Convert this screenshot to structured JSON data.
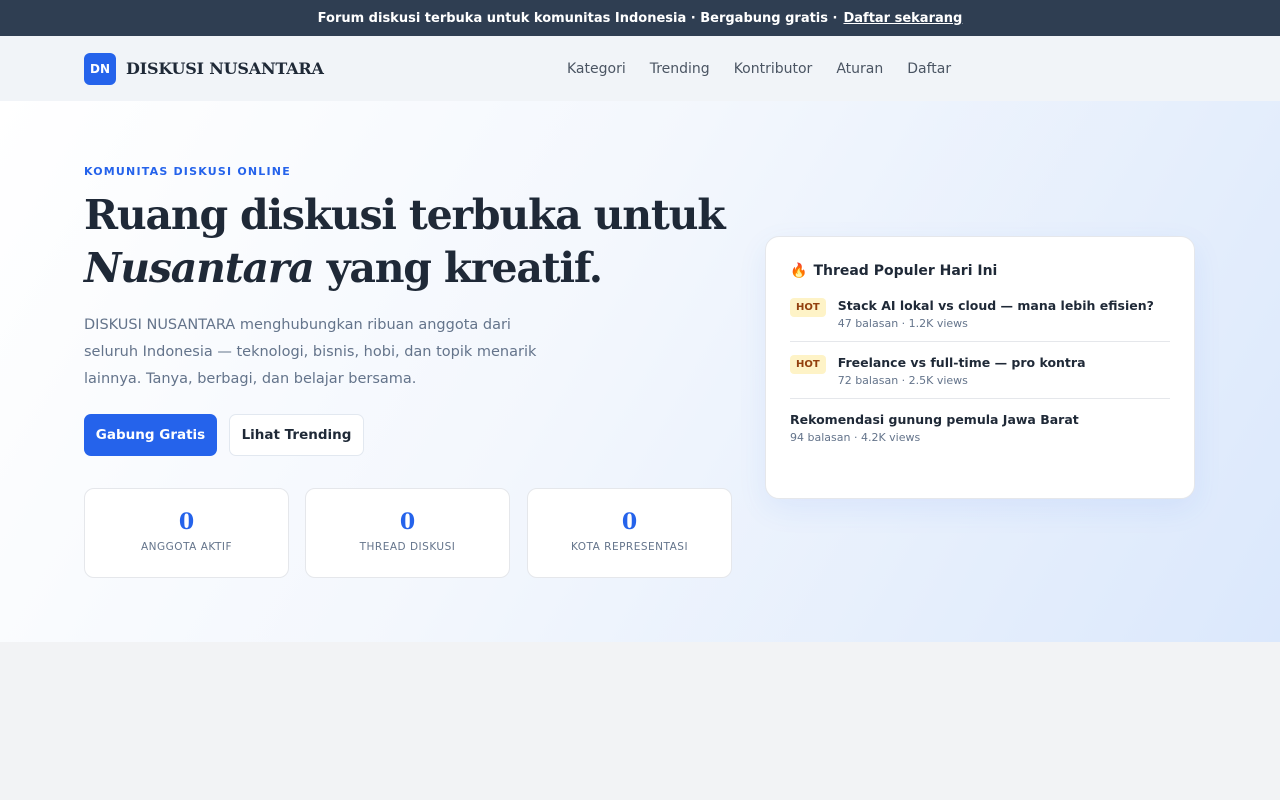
{
  "announcement": {
    "text": "Forum diskusi terbuka untuk komunitas Indonesia · Bergabung gratis ·",
    "link": "Daftar sekarang"
  },
  "header": {
    "logo_initials": "DN",
    "brand": "DISKUSI NUSANTARA",
    "nav": [
      "Kategori",
      "Trending",
      "Kontributor",
      "Aturan",
      "Daftar"
    ]
  },
  "hero": {
    "eyebrow": "KOMUNITAS DISKUSI ONLINE",
    "headline_line1": "Ruang diskusi terbuka untuk",
    "headline_italic": "Nusantara",
    "headline_line2_rest": " yang kreatif.",
    "lede": "DISKUSI NUSANTARA menghubungkan ribuan anggota dari seluruh Indonesia — teknologi, bisnis, hobi, dan topik menarik lainnya. Tanya, berbagi, dan belajar bersama.",
    "primary_cta": "Gabung Gratis",
    "secondary_cta": "Lihat Trending"
  },
  "stats": [
    {
      "value": "0",
      "label": "ANGGOTA AKTIF"
    },
    {
      "value": "0",
      "label": "THREAD DISKUSI"
    },
    {
      "value": "0",
      "label": "KOTA REPRESENTASI"
    }
  ],
  "popular": {
    "icon": "fire-icon",
    "icon_glyph": "🔥",
    "title": "Thread Populer Hari Ini",
    "threads": [
      {
        "badge": "HOT",
        "title": "Stack AI lokal vs cloud — mana lebih efisien?",
        "meta": "47 balasan · 1.2K views"
      },
      {
        "badge": "HOT",
        "title": "Freelance vs full-time — pro kontra",
        "meta": "72 balasan · 2.5K views"
      },
      {
        "badge": "",
        "title": "Rekomendasi gunung pemula Jawa Barat",
        "meta": "94 balasan · 4.2K views"
      }
    ]
  },
  "colors": {
    "accent": "#2563eb",
    "announce_bg": "#2f3e52",
    "hot_bg": "#fef3c7",
    "hot_text": "#92400e"
  }
}
